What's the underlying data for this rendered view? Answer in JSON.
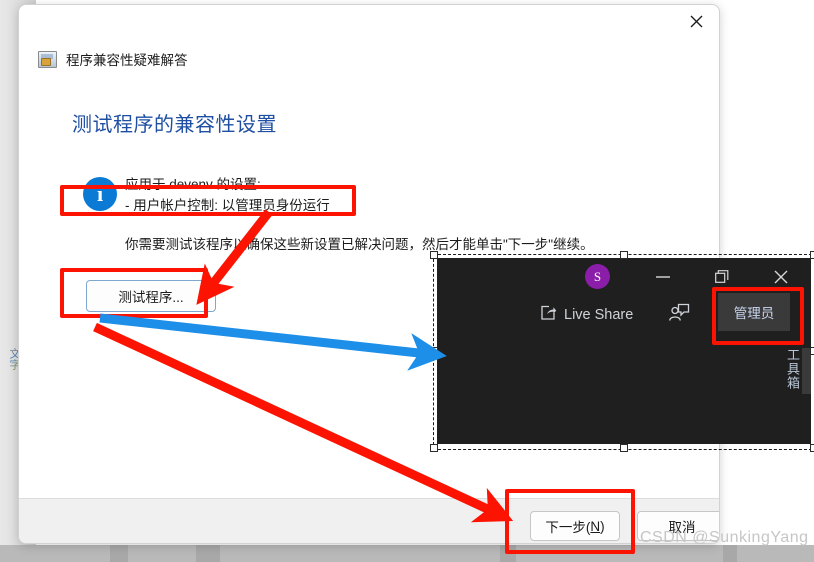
{
  "dialog": {
    "close_icon": "close-icon",
    "title": "程序兼容性疑难解答",
    "heading": "测试程序的兼容性设置",
    "info": {
      "icon": "info-icon",
      "line1": "应用于 devenv 的设置:",
      "line2": "- 用户帐户控制: 以管理员身份运行"
    },
    "paragraph": "你需要测试该程序以确保这些新设置已解决问题，然后才能单击\"下一步\"继续。",
    "test_button": "测试程序...",
    "footer": {
      "next_label_pre": "下一步(",
      "next_label_key": "N",
      "next_label_post": ")",
      "next_label": "下一步(N)",
      "cancel_label": "取消"
    }
  },
  "vs_window": {
    "avatar_initial": "S",
    "minimize_icon": "—",
    "maximize_icon": "❐",
    "close_icon": "✕",
    "live_share_label": "Live Share",
    "accounts_icon": "accounts-icon",
    "admin_badge": "管理员",
    "toolbox_label": "工具箱"
  },
  "annotations": {
    "highlight_color": "#fc1302",
    "arrow_blue_color": "#1e8fe8",
    "boxes": [
      "用户帐户控制: 以管理员身份运行",
      "测试程序...",
      "管理员",
      "下一步(N)"
    ]
  },
  "watermark": "CSDN @SunkingYang"
}
